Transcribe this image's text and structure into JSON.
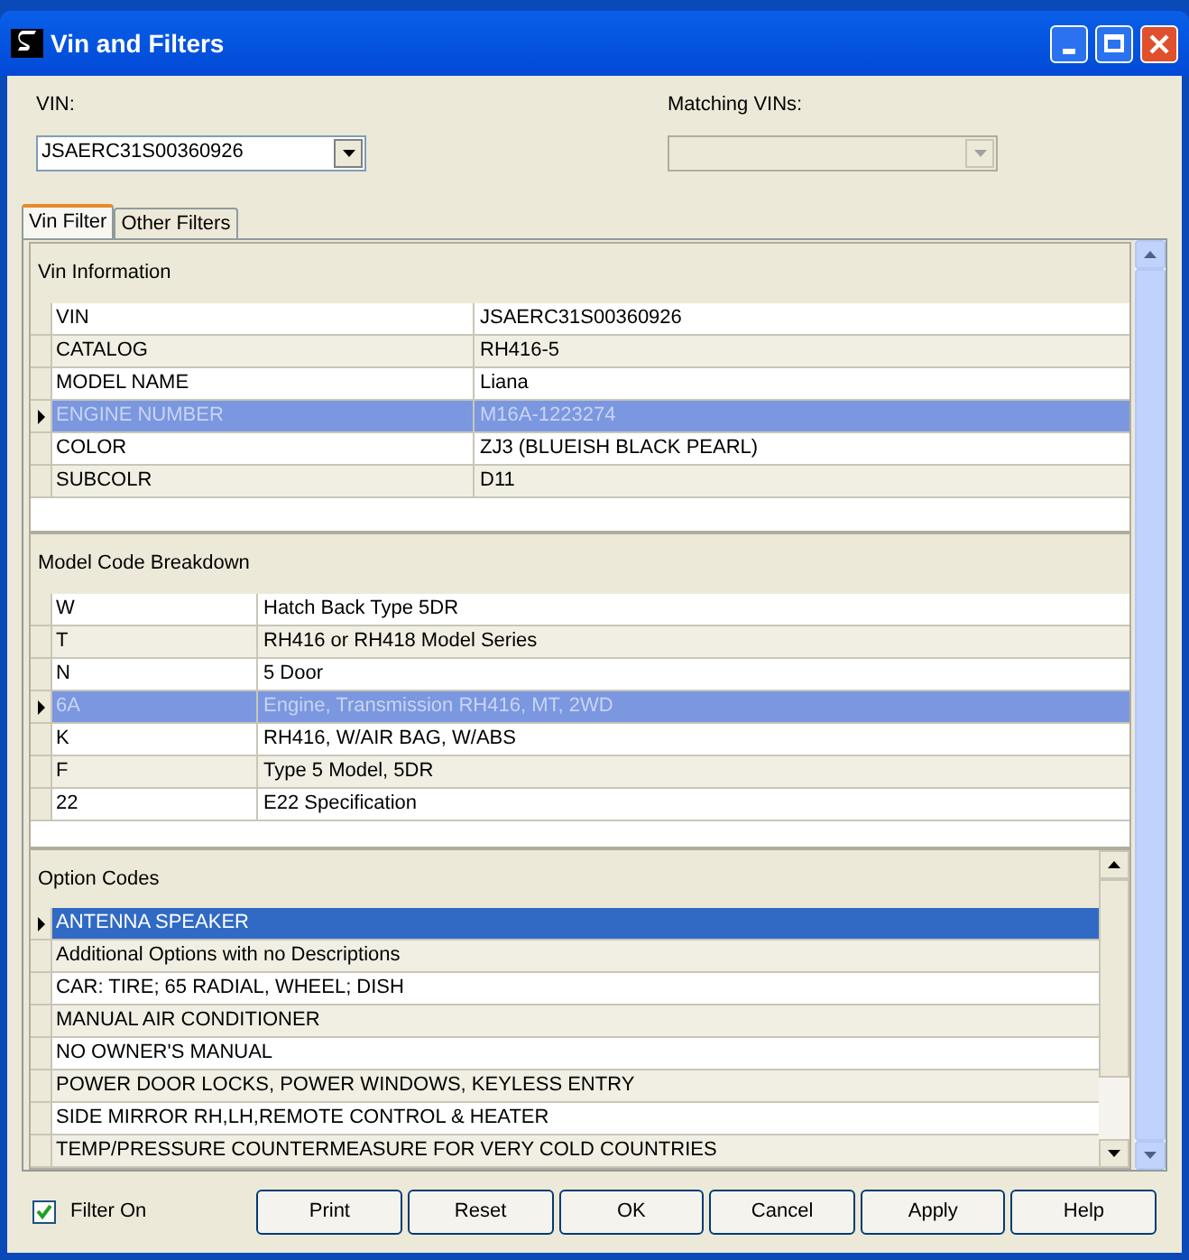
{
  "window": {
    "title": "Vin and Filters"
  },
  "vin": {
    "label": "VIN:",
    "value": "JSAERC31S00360926"
  },
  "matching_vins": {
    "label": "Matching VINs:",
    "disabled": true
  },
  "tabs": [
    {
      "label": "Vin Filter",
      "selected": true
    },
    {
      "label": "Other Filters",
      "selected": false
    }
  ],
  "vin_information": {
    "title": "Vin Information",
    "rows": [
      {
        "field": "VIN",
        "value": "JSAERC31S00360926",
        "selected": false
      },
      {
        "field": "CATALOG",
        "value": "RH416-5",
        "selected": false
      },
      {
        "field": "MODEL NAME",
        "value": "Liana",
        "selected": false
      },
      {
        "field": "ENGINE NUMBER",
        "value": "M16A-1223274",
        "selected": true
      },
      {
        "field": "COLOR",
        "value": "ZJ3 (BLUEISH BLACK PEARL)",
        "selected": false
      },
      {
        "field": "SUBCOLR",
        "value": "D11",
        "selected": false
      }
    ]
  },
  "model_code_breakdown": {
    "title": "Model Code Breakdown",
    "rows": [
      {
        "field": "W",
        "value": "Hatch Back Type 5DR",
        "selected": false
      },
      {
        "field": "T",
        "value": "RH416 or RH418 Model Series",
        "selected": false
      },
      {
        "field": "N",
        "value": "5 Door",
        "selected": false
      },
      {
        "field": "6A",
        "value": "Engine, Transmission RH416, MT, 2WD",
        "selected": true
      },
      {
        "field": "K",
        "value": "RH416, W/AIR BAG, W/ABS",
        "selected": false
      },
      {
        "field": "F",
        "value": "Type 5 Model, 5DR",
        "selected": false
      },
      {
        "field": "22",
        "value": "E22 Specification",
        "selected": false
      }
    ]
  },
  "option_codes": {
    "title": "Option Codes",
    "rows": [
      {
        "value": "ANTENNA SPEAKER",
        "selected": true
      },
      {
        "value": "Additional Options with no Descriptions",
        "selected": false
      },
      {
        "value": "CAR: TIRE; 65 RADIAL, WHEEL; DISH",
        "selected": false
      },
      {
        "value": "MANUAL AIR CONDITIONER",
        "selected": false
      },
      {
        "value": "NO OWNER'S MANUAL",
        "selected": false
      },
      {
        "value": "POWER DOOR LOCKS, POWER WINDOWS, KEYLESS ENTRY",
        "selected": false
      },
      {
        "value": "SIDE MIRROR RH,LH,REMOTE CONTROL & HEATER",
        "selected": false
      },
      {
        "value": "TEMP/PRESSURE COUNTERMEASURE FOR VERY COLD COUNTRIES",
        "selected": false
      }
    ]
  },
  "filter_on": {
    "label": "Filter On",
    "checked": true
  },
  "buttons": [
    "Print",
    "Reset",
    "OK",
    "Cancel",
    "Apply",
    "Help"
  ]
}
